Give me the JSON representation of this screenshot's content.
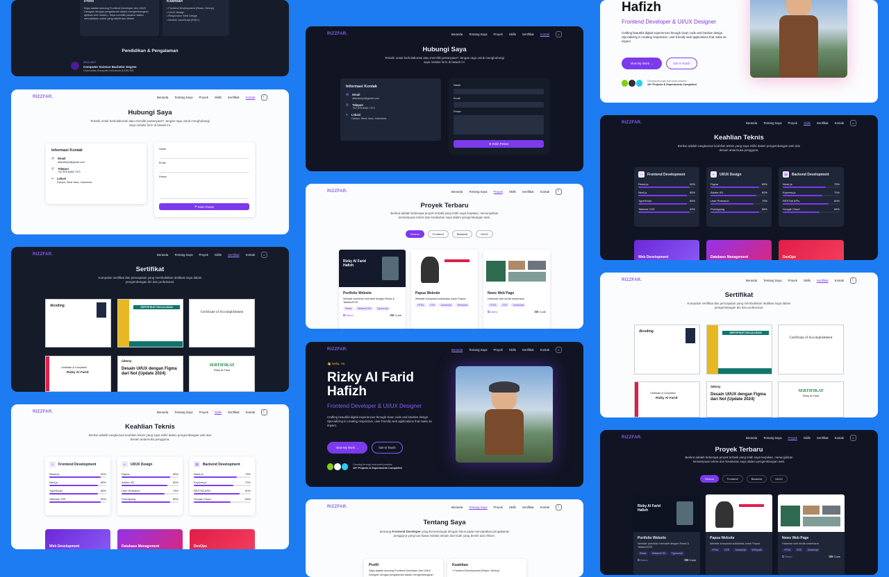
{
  "brand": "RIZZFAR.",
  "nav": {
    "home": "Beranda",
    "about": "Tentang Saya",
    "projects": "Proyek",
    "skills": "Skills",
    "certs": "Sertifikat",
    "contact": "Kontak"
  },
  "contact": {
    "title": "Hubungi Saya",
    "subtitle": "Tertarik untuk berkolaborasi atau memiliki pertanyaan? Jangan ragu untuk menghubungi saya melalui form di bawah ini.",
    "info_title": "Informasi Kontak",
    "email_label": "Email",
    "email": "alfarizkiiy4@gmail.com",
    "phone_label": "Telepon",
    "phone": "+62 878 8466 7371",
    "loc_label": "Lokasi",
    "loc": "Cianjur, West Java, Indonesia.",
    "name": "Name",
    "email_field": "Email",
    "message": "Pesan",
    "send": "Kirim Pesan"
  },
  "certs": {
    "title": "Sertifikat",
    "subtitle": "Kumpulan sertifikat dan pencapaian yang membuktikan dedikasi saya dalam pengembangan diri dan profesional.",
    "c1": "dicoding",
    "c2": "SERTIFIKAT KELULUSAN",
    "c3": "Certificate of Accomplishment",
    "c4": "Certificate of Completion",
    "c4name": "Rizky Al Farid",
    "c5brand": "ûdemy",
    "c5": "Desain UI/UX dengan Figma dari Nol (Update 2024)",
    "c6": "SERTIFIKAT",
    "c6name": "Rizky Al Farid"
  },
  "skills": {
    "title": "Keahlian Teknis",
    "subtitle": "Berikut adalah rangkuman keahlian teknis yang saya miliki dalam pengembangan web dan desain antarmuka pengguna.",
    "groups": [
      {
        "name": "Frontend Development",
        "items": [
          [
            "React.js",
            "90%",
            0.9
          ],
          [
            "Next.js",
            "85%",
            0.85
          ],
          [
            "TypeScript",
            "85%",
            0.85
          ],
          [
            "Tailwind CSS",
            "90%",
            0.9
          ]
        ]
      },
      {
        "name": "UI/UX Design",
        "items": [
          [
            "Figma",
            "85%",
            0.85
          ],
          [
            "Adobe XD",
            "80%",
            0.8
          ],
          [
            "User Research",
            "75%",
            0.75
          ],
          [
            "Prototyping",
            "85%",
            0.85
          ]
        ]
      },
      {
        "name": "Backend Development",
        "items": [
          [
            "Node.js",
            "75%",
            0.75
          ],
          [
            "Express.js",
            "70%",
            0.7
          ],
          [
            "RESTful APIs",
            "80%",
            0.8
          ],
          [
            "Google Cloud",
            "65%",
            0.65
          ]
        ]
      }
    ],
    "g1": "Web Development",
    "g2": "Database Management",
    "g3": "DevOps"
  },
  "projects": {
    "title": "Proyek Terbaru",
    "subtitle": "Berikut adalah beberapa proyek terbaik yang telah saya kerjakan, menunjukkan kemampuan teknis dan kreativitas saya dalam pengembangan web.",
    "filters": [
      "Semua",
      "Frontend",
      "Backend",
      "UI/UX"
    ],
    "p1": "Portfolio Website",
    "p1d": "Website portofolio interaktif dengan React & TailwindCSS",
    "p1t": [
      "React",
      "TailwindCSS",
      "Typescript"
    ],
    "p2": "Papua Website",
    "p2d": "Website komposisi solidaritas untuk Papua",
    "p2t": [
      "HTML",
      "CSS",
      "Javascript",
      "Webpack"
    ],
    "p3": "News Web Page",
    "p3d": "Halaman web berita sederhana",
    "p3t": [
      "HTML",
      "CSS",
      "Javascript"
    ],
    "demo": "Demo",
    "code": "Code",
    "thumb_name": "Rizky Al Farid Hafizh"
  },
  "hero": {
    "hello": "👋 Hello, I'm",
    "name1": "Rizky Al Farid",
    "name2": "Hafizh",
    "role": "Frontend Developer & UI/UX Designer",
    "desc": "Crafting beautiful digital experiences through clean code and intuitive design. Specializing in creating responsive, user-friendly web applications that make an impact.",
    "work": "View My Work",
    "touch": "Get In Touch",
    "growth": "Growing through real-world practice",
    "count": "15+ Projects & Experiments Completed"
  },
  "about": {
    "title": "Tentang Saya",
    "intro_pre": "Seorang ",
    "intro_bold": "Frontend Developer",
    "intro_post": " yang bersemangat dengan fokus pada menciptakan pengalaman pengguna yang luar biasa melalui desain dan kode yang bersih dan efisien.",
    "profile": "Profil",
    "profile_text": "Saya adalah seorang Frontend Developer dan UI/UX Designer dengan pengalaman dalam mengembangkan aplikasi web modern. Saya memiliki passion dalam menciptakan solusi yang efektif dan efisien.",
    "skills": "Keahlian",
    "skill_list": [
      "• Frontend Development (React, Next.js)",
      "• UI/UX Design",
      "• Responsive Web Design",
      "• Modern JavaScript (ES6+)"
    ],
    "edu_title": "Pendidikan & Pengalaman",
    "edu_year": "2023-2027",
    "edu_degree": "Computer Science Bachelor Degree",
    "edu_school": "Universitas Komputer Indonesia (UNIKOM)"
  },
  "colors": {
    "accent": "#7c3aed",
    "background": "#1d7cf2"
  }
}
